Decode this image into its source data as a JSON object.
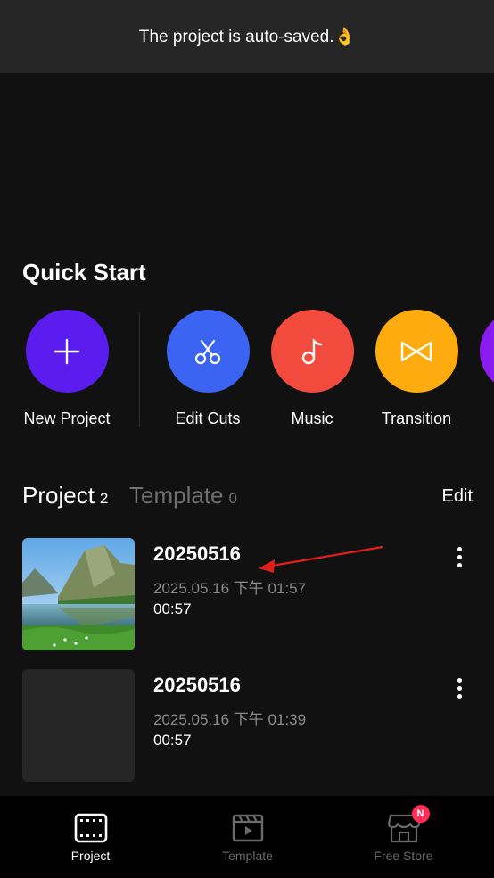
{
  "toast": {
    "message": "The project is auto-saved.👌"
  },
  "quick_start": {
    "title": "Quick Start",
    "items": [
      {
        "label": "New Project",
        "color": "#5b1cf0",
        "icon": "plus-icon"
      },
      {
        "label": "Edit Cuts",
        "color": "#3b64f2",
        "icon": "scissors-icon"
      },
      {
        "label": "Music",
        "color": "#f24a3d",
        "icon": "music-note-icon"
      },
      {
        "label": "Transition",
        "color": "#fdab0e",
        "icon": "bowtie-icon"
      },
      {
        "label": "",
        "color": "#8a1cf0",
        "icon": "partial-icon"
      }
    ]
  },
  "tabs": [
    {
      "label": "Project",
      "count": "2",
      "active": true
    },
    {
      "label": "Template",
      "count": "0",
      "active": false
    }
  ],
  "edit_label": "Edit",
  "projects": [
    {
      "name": "20250516",
      "date": "2025.05.16 下午 01:57",
      "duration": "00:57",
      "has_thumbnail": true
    },
    {
      "name": "20250516",
      "date": "2025.05.16 下午 01:39",
      "duration": "00:57",
      "has_thumbnail": false
    }
  ],
  "bottom_nav": [
    {
      "label": "Project",
      "active": true,
      "icon": "film-icon"
    },
    {
      "label": "Template",
      "active": false,
      "icon": "clapperboard-icon"
    },
    {
      "label": "Free Store",
      "active": false,
      "icon": "store-icon",
      "badge": "N"
    }
  ],
  "colors": {
    "background": "#111111",
    "toast": "#262626",
    "nav": "#000000",
    "badge": "#ff2d55",
    "annotation": "#e0201b"
  }
}
